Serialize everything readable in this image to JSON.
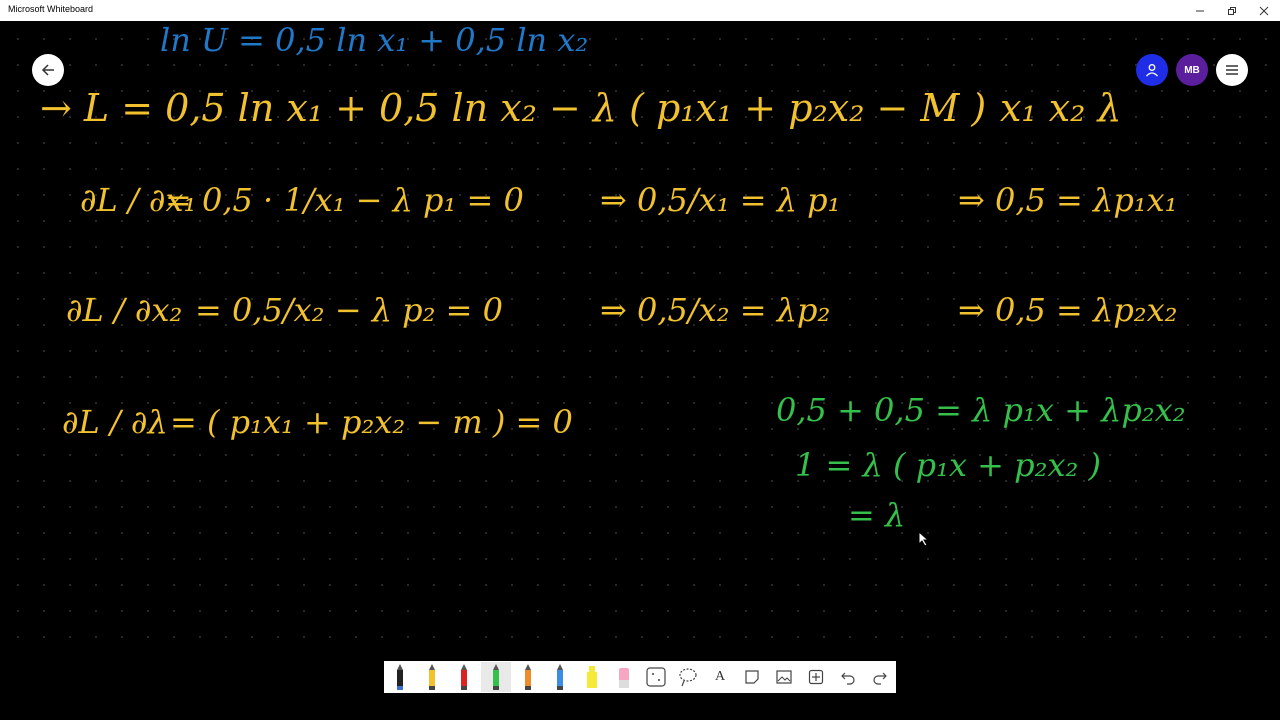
{
  "window": {
    "title": "Microsoft Whiteboard",
    "minimize_icon": "minimize-icon",
    "restore_icon": "restore-icon",
    "close_icon": "close-icon"
  },
  "header": {
    "avatar_initials": "MB"
  },
  "colors": {
    "ink_yellow": "#f2c12e",
    "ink_green": "#34c04a",
    "ink_blue": "#1f78c8",
    "ink_white": "#ffffff",
    "user_button": "#1f2ee6",
    "avatar": "#5b1f9e"
  },
  "ink": {
    "line_top_blue": "ln U = 0,5 ln x₁ + 0,5 ln x₂",
    "lagrangian": "→ L = 0,5 ln x₁ + 0,5 ln x₂ − λ ( p₁x₁ + p₂x₂ − M )",
    "variables": "x₁   x₂   λ",
    "dL_dx1_lhs": "∂L / ∂x₁",
    "dL_dx1_rhs": "= 0,5 · 1/x₁ − λ p₁ = 0",
    "dL_dx1_step": "⇒ 0,5/x₁ = λ p₁",
    "dL_dx1_result": "⇒ 0,5 = λp₁x₁",
    "dL_dx2_lhs": "∂L / ∂x₂",
    "dL_dx2_rhs": "= 0,5/x₂ − λ p₂ = 0",
    "dL_dx2_step": "⇒ 0,5/x₂ = λp₂",
    "dL_dx2_result": "⇒ 0,5 = λp₂x₂",
    "dL_dlambda_lhs": "∂L / ∂λ",
    "dL_dlambda_rhs": "= ( p₁x₁ + p₂x₂ − m ) = 0",
    "green_line1": "0,5 + 0,5 = λ p₁x + λp₂x₂",
    "green_line2": "1 = λ ( p₁x + p₂x₂ )",
    "green_line3": "= λ"
  },
  "toolbar": {
    "tools": [
      "pen-black",
      "pen-yellow",
      "pen-red",
      "pen-green",
      "pen-orange",
      "pen-blue",
      "highlighter-yellow",
      "eraser",
      "ruler",
      "lasso",
      "text",
      "sticky-note",
      "image",
      "insert",
      "undo",
      "redo"
    ],
    "active_tool": "pen-green",
    "text_tool_label": "A"
  }
}
